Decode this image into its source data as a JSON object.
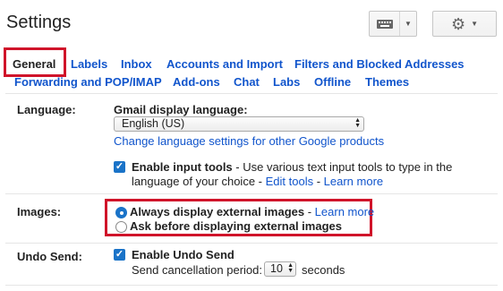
{
  "header": {
    "title": "Settings"
  },
  "tabs": [
    {
      "label": "General",
      "active": true
    },
    {
      "label": "Labels"
    },
    {
      "label": "Inbox"
    },
    {
      "label": "Accounts and Import"
    },
    {
      "label": "Filters and Blocked Addresses"
    },
    {
      "label": "Forwarding and POP/IMAP"
    },
    {
      "label": "Add-ons"
    },
    {
      "label": "Chat"
    },
    {
      "label": "Labs"
    },
    {
      "label": "Offline"
    },
    {
      "label": "Themes"
    }
  ],
  "language": {
    "label": "Language:",
    "sub_label": "Gmail display language:",
    "selected": "English (US)",
    "change_link": "Change language settings for other Google products",
    "input_tools_bold": "Enable input tools",
    "input_tools_text_1": " - Use various text input tools to type in the",
    "input_tools_text_2": "language of your choice - ",
    "edit_tools": "Edit tools",
    "sep": " - ",
    "learn_more": "Learn more"
  },
  "images": {
    "label": "Images:",
    "option1": "Always display external images",
    "sep": " - ",
    "learn_more": "Learn more",
    "option2": "Ask before displaying external images"
  },
  "undo": {
    "label": "Undo Send:",
    "enable": "Enable Undo Send",
    "period_label": "Send cancellation period:",
    "period_value": "10",
    "seconds": "seconds"
  },
  "colors": {
    "link": "#1155cc",
    "highlight": "#d0142a",
    "checkbox": "#1a73c8"
  }
}
